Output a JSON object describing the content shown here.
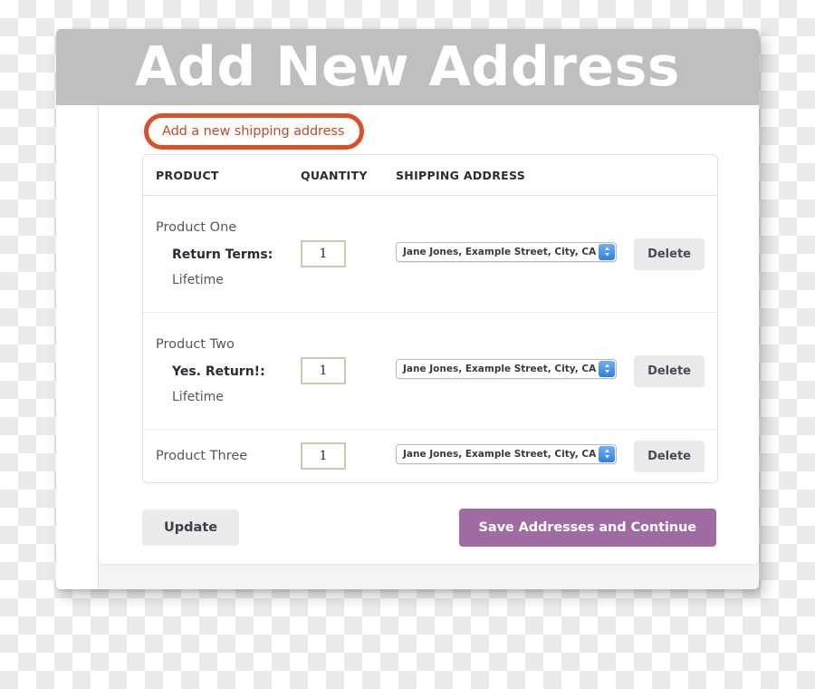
{
  "banner": {
    "title": "Add New Address"
  },
  "shipping_link": {
    "label": "Add a new shipping address",
    "annotation_color": "#d9512a",
    "text_color": "#c2492b"
  },
  "table": {
    "headers": {
      "product": "PRODUCT",
      "quantity": "QUANTITY",
      "shipping_address": "SHIPPING ADDRESS"
    },
    "rows": [
      {
        "product": "Product One",
        "return_label": "Return Terms:",
        "return_value": "Lifetime",
        "quantity": "1",
        "address": "Jane Jones, Example Street, City, CA",
        "delete_label": "Delete"
      },
      {
        "product": "Product Two",
        "return_label": "Yes. Return!:",
        "return_value": "Lifetime",
        "quantity": "1",
        "address": "Jane Jones, Example Street, City, CA",
        "delete_label": "Delete"
      },
      {
        "product": "Product Three",
        "return_label": "",
        "return_value": "",
        "quantity": "1",
        "address": "Jane Jones, Example Street, City, CA",
        "delete_label": "Delete"
      }
    ]
  },
  "actions": {
    "update_label": "Update",
    "save_label": "Save Addresses and Continue",
    "save_color": "#a06ba0"
  },
  "icons": {
    "select_stepper": "chevron-up-down-icon"
  }
}
